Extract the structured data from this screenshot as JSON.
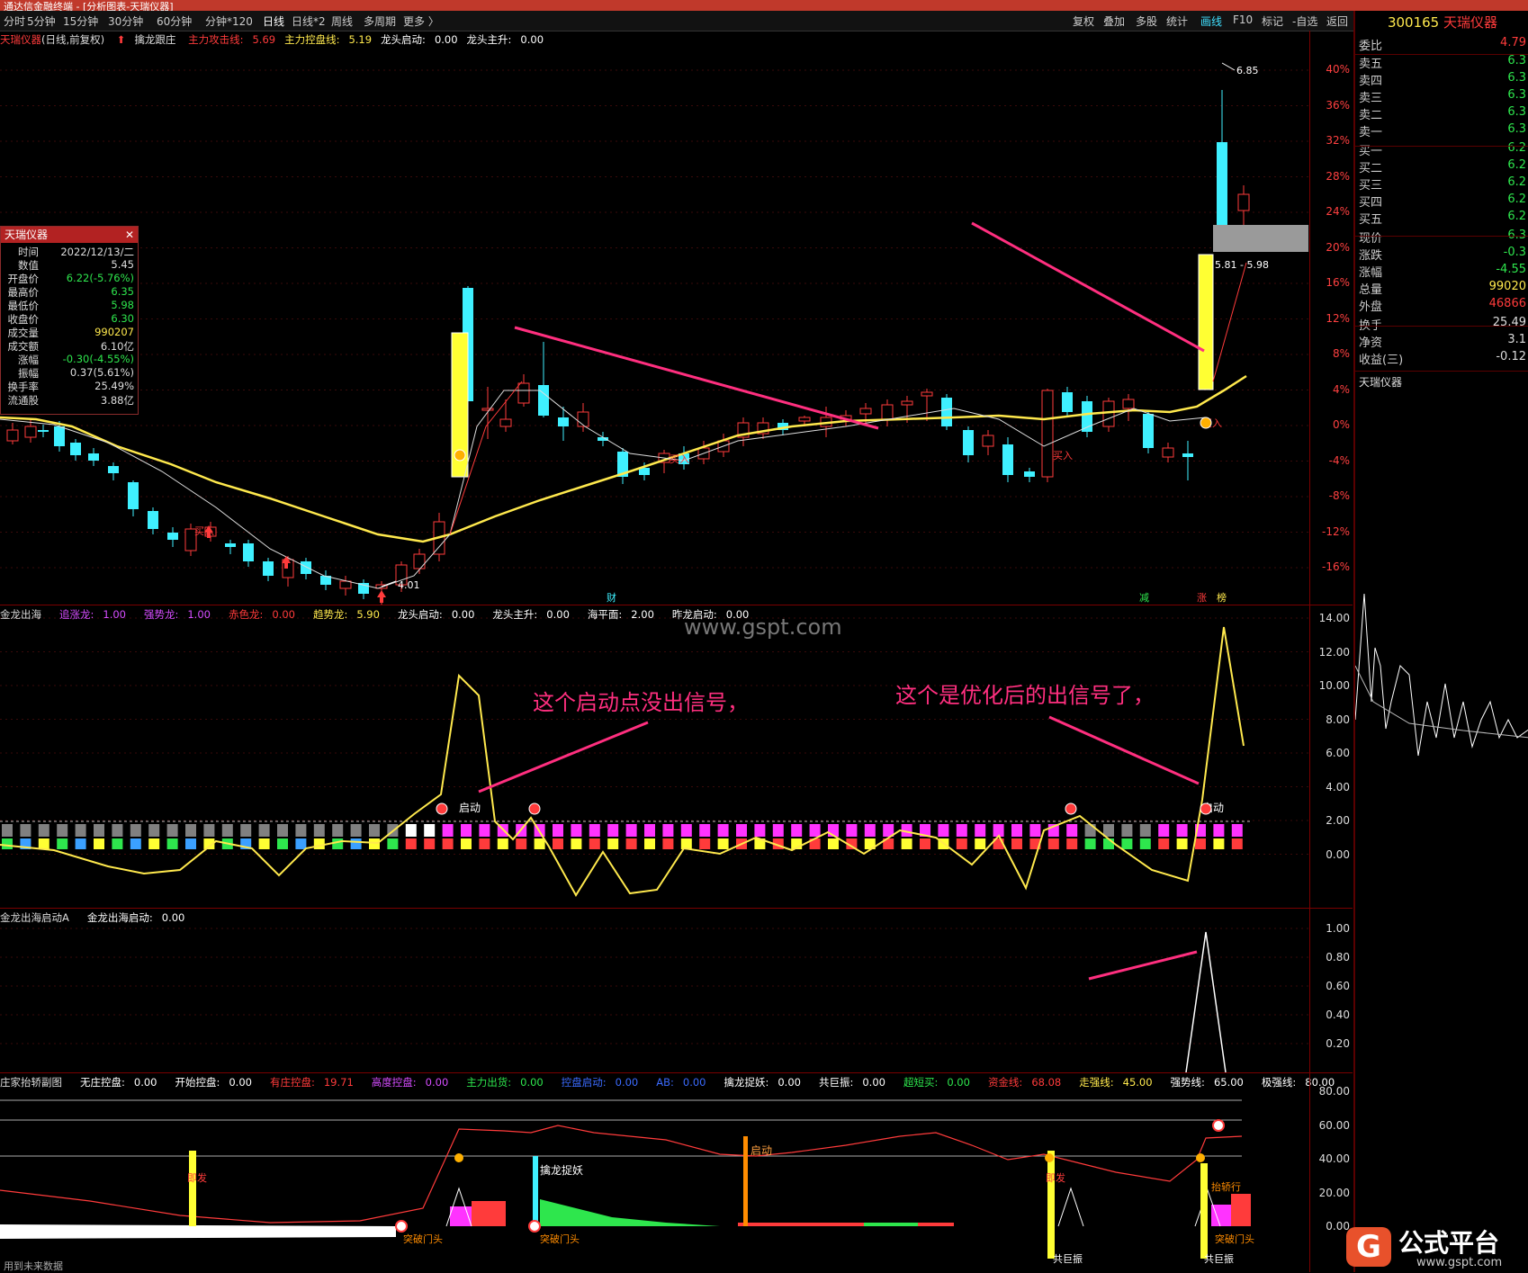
{
  "window": {
    "title": "通达信金融终端 - [分析图表-天瑞仪器]"
  },
  "toolbar": {
    "periods": [
      "分时",
      "5分钟",
      "15分钟",
      "30分钟",
      "60分钟",
      "分钟*120",
      "日线",
      "日线*2",
      "周线",
      "多周期",
      "更多 〉"
    ],
    "active_period": "日线",
    "right_buttons": [
      "复权",
      "叠加",
      "多股",
      "统计",
      "画线",
      "F10",
      "标记",
      "-自选",
      "返回"
    ],
    "highlighted_button": "画线"
  },
  "main_panel": {
    "header": {
      "stock": "天瑞仪器",
      "mode": "(日线,前复权)",
      "indicator": "擒龙跟庄",
      "items": [
        {
          "label": "主力攻击线:",
          "value": "5.69",
          "color": "#ff3b3b"
        },
        {
          "label": "主力控盘线:",
          "value": "5.19",
          "color": "#ffe94d"
        },
        {
          "label": "龙头启动:",
          "value": "0.00",
          "color": "#ffffff"
        },
        {
          "label": "龙头主升:",
          "value": "0.00",
          "color": "#ffffff"
        }
      ]
    },
    "y_axis": [
      "40%",
      "36%",
      "32%",
      "28%",
      "24%",
      "20%",
      "16%",
      "12%",
      "8%",
      "4%",
      "0%",
      "-4%",
      "-8%",
      "-12%",
      "-16%"
    ],
    "price_high": "6.85",
    "price_low": "4.01",
    "range_label": "5.81 - 5.98",
    "buy_label": "买入",
    "bottom_tags": [
      "财",
      "减",
      "涨",
      "榜"
    ]
  },
  "info_box": {
    "title": "天瑞仪器",
    "rows": [
      {
        "k": "时间",
        "v": "2022/12/13/二",
        "c": "w"
      },
      {
        "k": "数值",
        "v": "5.45",
        "c": "w"
      },
      {
        "k": "开盘价",
        "v": "6.22(-5.76%)",
        "c": "g"
      },
      {
        "k": "最高价",
        "v": "6.35",
        "c": "g"
      },
      {
        "k": "最低价",
        "v": "5.98",
        "c": "g"
      },
      {
        "k": "收盘价",
        "v": "6.30",
        "c": "g"
      },
      {
        "k": "成交量",
        "v": "990207",
        "c": "y"
      },
      {
        "k": "成交额",
        "v": "6.10亿",
        "c": "w"
      },
      {
        "k": "涨幅",
        "v": "-0.30(-4.55%)",
        "c": "g"
      },
      {
        "k": "振幅",
        "v": "0.37(5.61%)",
        "c": "w"
      },
      {
        "k": "换手率",
        "v": "25.49%",
        "c": "w"
      },
      {
        "k": "流通股",
        "v": "3.88亿",
        "c": "w"
      }
    ]
  },
  "panel2": {
    "header": [
      {
        "label": "金龙出海",
        "value": "",
        "color": "#dddddd"
      },
      {
        "label": "追涨龙:",
        "value": "1.00",
        "color": "#d54dff"
      },
      {
        "label": "强势龙:",
        "value": "1.00",
        "color": "#d54dff"
      },
      {
        "label": "赤色龙:",
        "value": "0.00",
        "color": "#ff3b3b"
      },
      {
        "label": "趋势龙:",
        "value": "5.90",
        "color": "#ffe94d"
      },
      {
        "label": "龙头启动:",
        "value": "0.00",
        "color": "#ffffff"
      },
      {
        "label": "龙头主升:",
        "value": "0.00",
        "color": "#ffffff"
      },
      {
        "label": "海平面:",
        "value": "2.00",
        "color": "#ffffff"
      },
      {
        "label": "昨龙启动:",
        "value": "0.00",
        "color": "#ffffff"
      }
    ],
    "y_axis": [
      "14.00",
      "12.00",
      "10.00",
      "8.00",
      "6.00",
      "4.00",
      "2.00",
      "0.00"
    ],
    "start_label": "启动",
    "watermark": "www.gspt.com",
    "note_left": "这个启动点没出信号，",
    "note_right": "这个是优化后的出信号了，"
  },
  "panel3": {
    "header": [
      {
        "label": "金龙出海启动A",
        "value": "",
        "color": "#dddddd"
      },
      {
        "label": "金龙出海启动:",
        "value": "0.00",
        "color": "#ffffff"
      }
    ],
    "y_axis": [
      "1.00",
      "0.80",
      "0.60",
      "0.40",
      "0.20"
    ]
  },
  "panel4": {
    "header": [
      {
        "label": "庄家抬轿副图",
        "value": "",
        "color": "#dddddd"
      },
      {
        "label": "无庄控盘:",
        "value": "0.00",
        "color": "#ffffff"
      },
      {
        "label": "开始控盘:",
        "value": "0.00",
        "color": "#ffffff"
      },
      {
        "label": "有庄控盘:",
        "value": "19.71",
        "color": "#ff3b3b"
      },
      {
        "label": "高度控盘:",
        "value": "0.00",
        "color": "#d54dff"
      },
      {
        "label": "主力出货:",
        "value": "0.00",
        "color": "#2ee64d"
      },
      {
        "label": "控盘启动:",
        "value": "0.00",
        "color": "#3b6bff"
      },
      {
        "label": "AB:",
        "value": "0.00",
        "color": "#3b6bff"
      },
      {
        "label": "擒龙捉妖:",
        "value": "0.00",
        "color": "#ffffff"
      },
      {
        "label": "共巨振:",
        "value": "0.00",
        "color": "#ffffff"
      },
      {
        "label": "超短买:",
        "value": "0.00",
        "color": "#2ee64d"
      },
      {
        "label": "资金线:",
        "value": "68.08",
        "color": "#ff3b3b"
      },
      {
        "label": "走强线:",
        "value": "45.00",
        "color": "#ffe94d"
      },
      {
        "label": "强势线:",
        "value": "65.00",
        "color": "#ffffff"
      },
      {
        "label": "极强线:",
        "value": "80.00",
        "color": "#ffffff"
      }
    ],
    "y_axis": [
      "80.00",
      "60.00",
      "40.00",
      "20.00",
      "0.00"
    ],
    "labels": {
      "catch": "擒龙捉妖",
      "start": "启动",
      "breakout": "突破门头",
      "resonance": "共巨振",
      "launch": "即发",
      "lift": "抬轿行"
    },
    "footer": "用到未来数据"
  },
  "quote": {
    "code": "300165",
    "name": "天瑞仪器",
    "weibi": {
      "label": "委比",
      "value": "4.79"
    },
    "sell": [
      {
        "label": "卖五",
        "value": "6.3"
      },
      {
        "label": "卖四",
        "value": "6.3"
      },
      {
        "label": "卖三",
        "value": "6.3"
      },
      {
        "label": "卖二",
        "value": "6.3"
      },
      {
        "label": "卖一",
        "value": "6.3"
      }
    ],
    "buy": [
      {
        "label": "买一",
        "value": "6.2"
      },
      {
        "label": "买二",
        "value": "6.2"
      },
      {
        "label": "买三",
        "value": "6.2"
      },
      {
        "label": "买四",
        "value": "6.2"
      },
      {
        "label": "买五",
        "value": "6.2"
      }
    ],
    "stats": [
      {
        "label": "现价",
        "value": "6.3",
        "c": "g"
      },
      {
        "label": "涨跌",
        "value": "-0.3",
        "c": "g"
      },
      {
        "label": "涨幅",
        "value": "-4.55",
        "c": "g"
      },
      {
        "label": "总量",
        "value": "99020",
        "c": "y"
      },
      {
        "label": "外盘",
        "value": "46866",
        "c": "r"
      }
    ],
    "stats2": [
      {
        "label": "换手",
        "value": "25.49",
        "c": "w"
      },
      {
        "label": "净资",
        "value": "3.1",
        "c": "w"
      },
      {
        "label": "收益(三)",
        "value": "-0.12",
        "c": "w"
      }
    ],
    "mini_title": "天瑞仪器"
  },
  "logo": {
    "name": "公式平台",
    "url": "www.gspt.com"
  },
  "colors": {
    "up": "#ff3b3b",
    "down": "#3ff0ff",
    "ma": "#ffe94d",
    "note": "#ff2f7f"
  }
}
